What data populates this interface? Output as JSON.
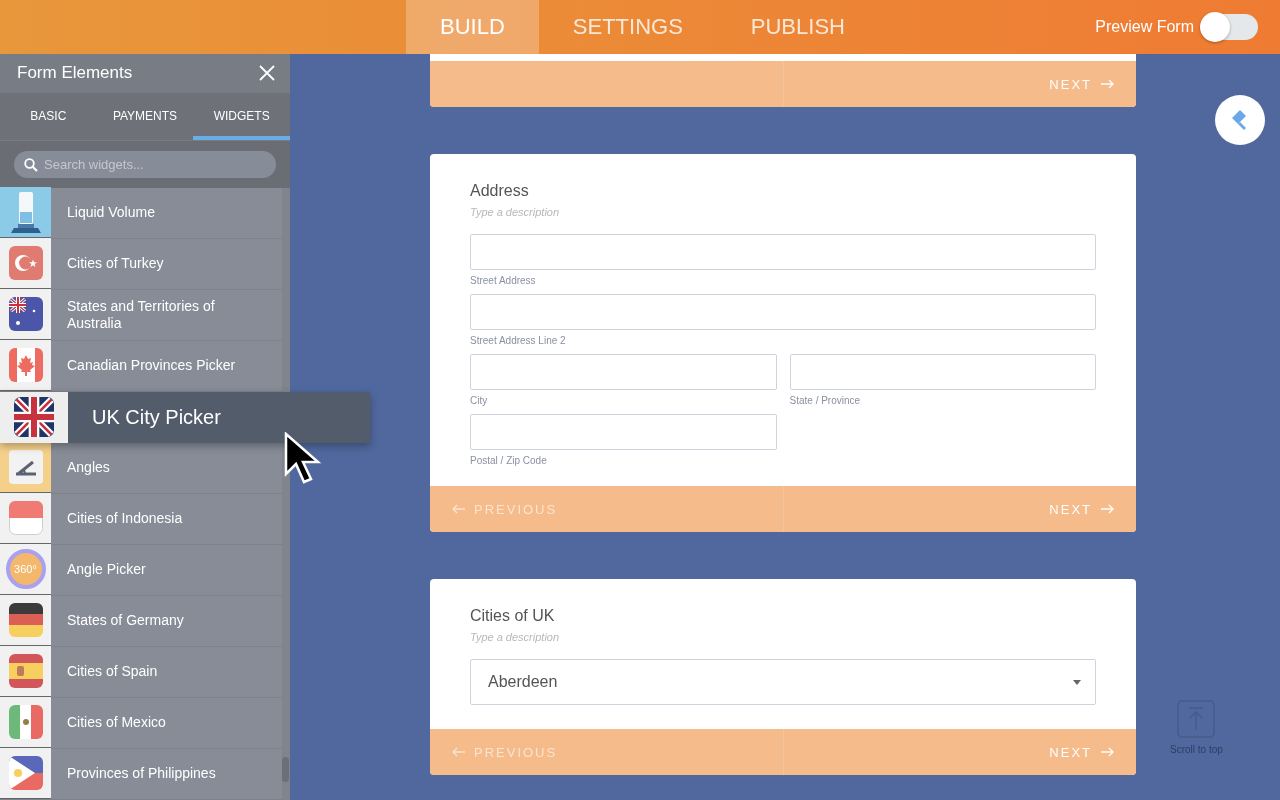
{
  "topbar": {
    "tabs": [
      {
        "label": "BUILD",
        "selected": true
      },
      {
        "label": "SETTINGS",
        "selected": false
      },
      {
        "label": "PUBLISH",
        "selected": false
      }
    ],
    "preview": {
      "label": "Preview Form",
      "on": false
    }
  },
  "sidebar": {
    "title": "Form Elements",
    "tabs": [
      {
        "label": "BASIC",
        "selected": false
      },
      {
        "label": "PAYMENTS",
        "selected": false
      },
      {
        "label": "WIDGETS",
        "selected": true
      }
    ],
    "search": {
      "placeholder": "Search widgets..."
    },
    "items": [
      {
        "label": "Liquid Volume",
        "kind": "widget"
      },
      {
        "label": "Cities of Turkey",
        "kind": "widget"
      },
      {
        "label": "States and Territories of Australia",
        "kind": "widget"
      },
      {
        "label": "Canadian Provinces Picker",
        "kind": "widget"
      },
      {
        "label": "UK City Picker",
        "kind": "dragging"
      },
      {
        "label": "Angles",
        "kind": "widget"
      },
      {
        "label": "Cities of Indonesia",
        "kind": "widget"
      },
      {
        "label": "Angle Picker",
        "kind": "widget",
        "badge": "360°"
      },
      {
        "label": "States of Germany",
        "kind": "widget"
      },
      {
        "label": "Cities of Spain",
        "kind": "widget"
      },
      {
        "label": "Cities of Mexico",
        "kind": "widget"
      },
      {
        "label": "Provinces of Philippines",
        "kind": "widget"
      }
    ]
  },
  "cards": [
    {
      "kind": "footer_only",
      "next": "NEXT"
    },
    {
      "kind": "address",
      "title": "Address",
      "description": "Type a description",
      "fields": [
        {
          "label": "Street Address",
          "kind": "full"
        },
        {
          "label": "Street Address Line 2",
          "kind": "full"
        },
        {
          "label": "City",
          "kind": "half"
        },
        {
          "label": "State / Province",
          "kind": "half"
        },
        {
          "label": "Postal / Zip Code",
          "kind": "half"
        }
      ],
      "previous": "PREVIOUS",
      "next": "NEXT"
    },
    {
      "kind": "dropdown",
      "title": "Cities of UK",
      "description": "Type a description",
      "dropdown": {
        "value": "Aberdeen"
      },
      "previous": "PREVIOUS",
      "next": "NEXT"
    }
  ],
  "scroll_to_top": {
    "label": "Scroll to top"
  }
}
